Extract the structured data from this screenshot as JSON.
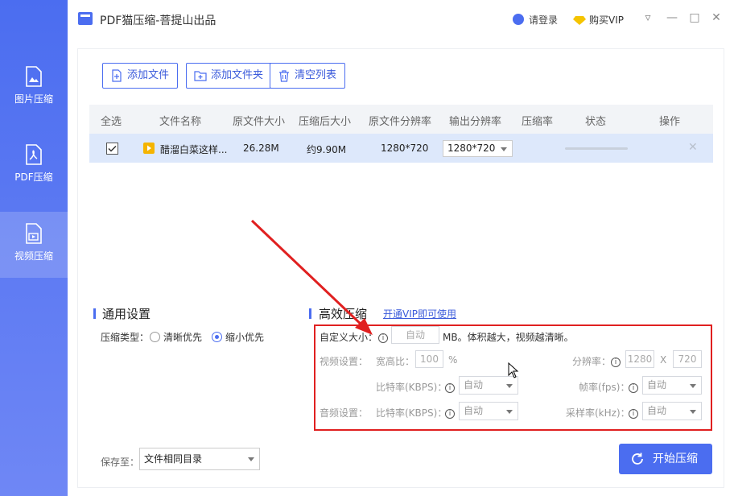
{
  "app": {
    "title": "PDF猫压缩-菩提山出品",
    "login": "请登录",
    "vip": "购买VIP"
  },
  "sidebar": {
    "items": [
      {
        "label": "图片压缩",
        "icon": "image-file-icon"
      },
      {
        "label": "PDF压缩",
        "icon": "pdf-file-icon"
      },
      {
        "label": "视频压缩",
        "icon": "video-file-icon",
        "active": true
      }
    ]
  },
  "toolbar": {
    "add_file": "添加文件",
    "add_folder": "添加文件夹",
    "clear_list": "清空列表"
  },
  "table": {
    "headers": [
      "全选",
      "文件名称",
      "原文件大小",
      "压缩后大小",
      "原文件分辨率",
      "输出分辨率",
      "压缩率",
      "状态",
      "操作"
    ],
    "rows": [
      {
        "checked": true,
        "name": "醋溜白菜这样...",
        "orig_size": "26.28M",
        "compressed_size": "约9.90M",
        "orig_res": "1280*720",
        "out_res": "1280*720",
        "ratio": "",
        "status_progress": 0
      }
    ]
  },
  "general": {
    "title": "通用设置",
    "type_label": "压缩类型：",
    "opt_clear": "清晰优先",
    "opt_small": "缩小优先",
    "selected": "缩小优先"
  },
  "efficient": {
    "title": "高效压缩",
    "vip_link": "开通VIP即可使用",
    "custom_size_label": "自定义大小：",
    "custom_size_value": "自动",
    "custom_size_hint": "MB。体积越大，视频越清晰。",
    "video_label": "视频设置：",
    "aspect_label": "宽高比：",
    "aspect_value": "100",
    "aspect_unit": "%",
    "resolution_label": "分辨率：",
    "res_w": "1280",
    "res_sep": "X",
    "res_h": "720",
    "bitrate_label": "比特率(KBPS)：",
    "bitrate_value": "自动",
    "fps_label": "帧率(fps)：",
    "fps_value": "自动",
    "audio_label": "音频设置：",
    "audio_bitrate_label": "比特率(KBPS)：",
    "audio_bitrate_value": "自动",
    "sample_label": "采样率(kHz)：",
    "sample_value": "自动"
  },
  "footer": {
    "save_label": "保存至：",
    "save_value": "文件相同目录",
    "start": "开始压缩"
  },
  "colors": {
    "accent": "#4b6df0",
    "highlight": "#e02020",
    "row_selected": "#dde8fb"
  }
}
